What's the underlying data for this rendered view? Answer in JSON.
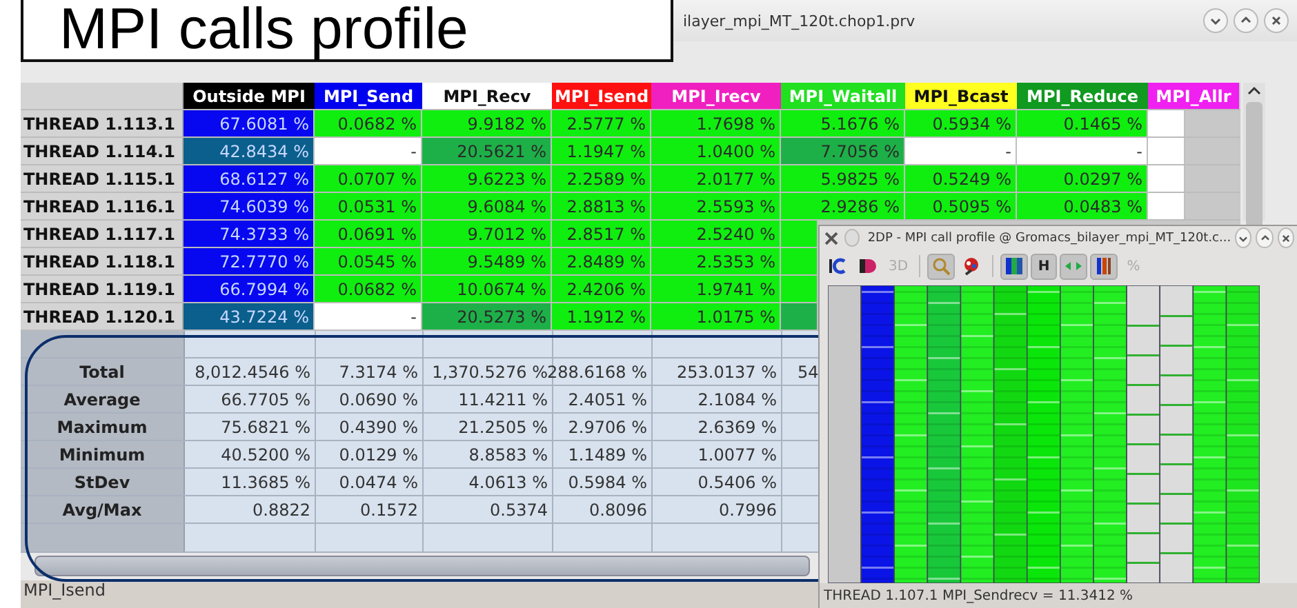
{
  "callout": {
    "title": "MPI calls profile"
  },
  "window": {
    "title": "ilayer_mpi_MT_120t.chop1.prv"
  },
  "table": {
    "columns": [
      {
        "name": "Outside MPI",
        "color": "#000000"
      },
      {
        "name": "MPI_Send",
        "color": "#0000f0"
      },
      {
        "name": "MPI_Recv",
        "color": "#ffffff"
      },
      {
        "name": "MPI_Isend",
        "color": "#ff1010"
      },
      {
        "name": "MPI_Irecv",
        "color": "#f020c0"
      },
      {
        "name": "MPI_Waitall",
        "color": "#20e020"
      },
      {
        "name": "MPI_Bcast",
        "color": "#ffff20"
      },
      {
        "name": "MPI_Reduce",
        "color": "#109a20"
      },
      {
        "name": "MPI_Allr",
        "color": "#f020f0"
      }
    ],
    "rows": [
      {
        "label": "THREAD 1.113.1",
        "cells": [
          {
            "value": "67.6081 %",
            "color": "#0808f0"
          },
          {
            "value": "0.0682 %",
            "color": "#10ee10"
          },
          {
            "value": "9.9182 %",
            "color": "#10ee10"
          },
          {
            "value": "2.5777 %",
            "color": "#10ee10"
          },
          {
            "value": "1.7698 %",
            "color": "#10ee10"
          },
          {
            "value": "5.1676 %",
            "color": "#10ee10"
          },
          {
            "value": "0.5934 %",
            "color": "#10ee10"
          },
          {
            "value": "0.1465 %",
            "color": "#10ee10"
          },
          {
            "color": "#ffffff"
          }
        ]
      },
      {
        "label": "THREAD 1.114.1",
        "cells": [
          {
            "value": "42.8434 %",
            "color": "#0a5f8c"
          },
          {
            "value": "-",
            "color": "#ffffff"
          },
          {
            "value": "20.5621 %",
            "color": "#1eb048"
          },
          {
            "value": "1.1947 %",
            "color": "#10ee10"
          },
          {
            "value": "1.0400 %",
            "color": "#10ee10"
          },
          {
            "value": "7.7056 %",
            "color": "#1eb048"
          },
          {
            "value": "-",
            "color": "#ffffff"
          },
          {
            "value": "-",
            "color": "#ffffff"
          },
          {
            "color": "#ffffff"
          }
        ]
      },
      {
        "label": "THREAD 1.115.1",
        "cells": [
          {
            "value": "68.6127 %",
            "color": "#0808f0"
          },
          {
            "value": "0.0707 %",
            "color": "#10ee10"
          },
          {
            "value": "9.6223 %",
            "color": "#10ee10"
          },
          {
            "value": "2.2589 %",
            "color": "#10ee10"
          },
          {
            "value": "2.0177 %",
            "color": "#10ee10"
          },
          {
            "value": "5.9825 %",
            "color": "#10ee10"
          },
          {
            "value": "0.5249 %",
            "color": "#10ee10"
          },
          {
            "value": "0.0297 %",
            "color": "#10ee10"
          },
          {
            "color": "#ffffff"
          }
        ]
      },
      {
        "label": "THREAD 1.116.1",
        "cells": [
          {
            "value": "74.6039 %",
            "color": "#0808f0"
          },
          {
            "value": "0.0531 %",
            "color": "#10ee10"
          },
          {
            "value": "9.6084 %",
            "color": "#10ee10"
          },
          {
            "value": "2.8813 %",
            "color": "#10ee10"
          },
          {
            "value": "2.5593 %",
            "color": "#10ee10"
          },
          {
            "value": "2.9286 %",
            "color": "#10ee10"
          },
          {
            "value": "0.5095 %",
            "color": "#10ee10"
          },
          {
            "value": "0.0483 %",
            "color": "#10ee10"
          },
          {
            "color": "#ffffff"
          }
        ]
      },
      {
        "label": "THREAD 1.117.1",
        "cells": [
          {
            "value": "74.3733 %",
            "color": "#0808f0"
          },
          {
            "value": "0.0691 %",
            "color": "#10ee10"
          },
          {
            "value": "9.7012 %",
            "color": "#10ee10"
          },
          {
            "value": "2.8517 %",
            "color": "#10ee10"
          },
          {
            "value": "2.5240 %",
            "color": "#10ee10"
          },
          {
            "color": "#10ee10"
          }
        ]
      },
      {
        "label": "THREAD 1.118.1",
        "cells": [
          {
            "value": "72.7770 %",
            "color": "#0808f0"
          },
          {
            "value": "0.0545 %",
            "color": "#10ee10"
          },
          {
            "value": "9.5489 %",
            "color": "#10ee10"
          },
          {
            "value": "2.8489 %",
            "color": "#10ee10"
          },
          {
            "value": "2.5353 %",
            "color": "#10ee10"
          },
          {
            "color": "#10ee10"
          }
        ]
      },
      {
        "label": "THREAD 1.119.1",
        "cells": [
          {
            "value": "66.7994 %",
            "color": "#0808f0"
          },
          {
            "value": "0.0682 %",
            "color": "#10ee10"
          },
          {
            "value": "10.0674 %",
            "color": "#10ee10"
          },
          {
            "value": "2.4206 %",
            "color": "#10ee10"
          },
          {
            "value": "1.9741 %",
            "color": "#10ee10"
          },
          {
            "color": "#10ee10"
          }
        ]
      },
      {
        "label": "THREAD 1.120.1",
        "cells": [
          {
            "value": "43.7224 %",
            "color": "#0a5f8c"
          },
          {
            "value": "-",
            "color": "#ffffff"
          },
          {
            "value": "20.5273 %",
            "color": "#1eb048"
          },
          {
            "value": "1.1912 %",
            "color": "#10ee10"
          },
          {
            "value": "1.0175 %",
            "color": "#10ee10"
          },
          {
            "color": "#1eb048"
          }
        ]
      }
    ],
    "stats": [
      {
        "label": "Total",
        "values": [
          "8,012.4546 %",
          "7.3174 %",
          "1,370.5276 %",
          "288.6168 %",
          "253.0137 %",
          "54"
        ]
      },
      {
        "label": "Average",
        "values": [
          "66.7705 %",
          "0.0690 %",
          "11.4211 %",
          "2.4051 %",
          "2.1084 %"
        ]
      },
      {
        "label": "Maximum",
        "values": [
          "75.6821 %",
          "0.4390 %",
          "21.2505 %",
          "2.9706 %",
          "2.6369 %"
        ]
      },
      {
        "label": "Minimum",
        "values": [
          "40.5200 %",
          "0.0129 %",
          "8.8583 %",
          "1.1489 %",
          "1.0077 %"
        ]
      },
      {
        "label": "StDev",
        "values": [
          "11.3685 %",
          "0.0474 %",
          "4.0613 %",
          "0.5984 %",
          "0.5406 %"
        ]
      },
      {
        "label": "Avg/Max",
        "values": [
          "0.8822",
          "0.1572",
          "0.5374",
          "0.8096",
          "0.7996"
        ]
      }
    ]
  },
  "status_bar": {
    "text": "MPI_Isend"
  },
  "popup": {
    "title": "2DP - MPI call profile @ Gromacs_bilayer_mpi_MT_120t.c...",
    "toolbar": [
      {
        "kind": "fit",
        "pressed": false
      },
      {
        "kind": "codes",
        "pressed": false
      },
      {
        "kind": "label",
        "label": "3D",
        "pressed": false,
        "disabled": true
      },
      {
        "kind": "separator"
      },
      {
        "kind": "zoom",
        "pressed": true
      },
      {
        "kind": "palette",
        "pressed": false
      },
      {
        "kind": "separator"
      },
      {
        "kind": "bars",
        "pressed": true
      },
      {
        "kind": "label",
        "label": "H",
        "pressed": true,
        "disabled": false
      },
      {
        "kind": "arrows",
        "pressed": true
      },
      {
        "kind": "stripes",
        "pressed": true
      },
      {
        "kind": "label",
        "label": "%",
        "pressed": false,
        "disabled": true
      }
    ],
    "columns": [
      {
        "kind": "empty",
        "color": "#c8c8c8"
      },
      {
        "kind": "striped",
        "color": "#0a14e6"
      },
      {
        "kind": "striped",
        "color": "#22ee22"
      },
      {
        "kind": "striped",
        "color": "#18c83a"
      },
      {
        "kind": "striped",
        "color": "#22ee22"
      },
      {
        "kind": "striped",
        "color": "#12d812"
      },
      {
        "kind": "striped",
        "color": "#0ae60a"
      },
      {
        "kind": "striped",
        "color": "#22ee22"
      },
      {
        "kind": "striped",
        "color": "#22ee22"
      },
      {
        "kind": "sparse",
        "color": "#dcdcdc"
      },
      {
        "kind": "sparse",
        "color": "#dcdcdc"
      },
      {
        "kind": "striped",
        "color": "#22ee22"
      },
      {
        "kind": "striped",
        "color": "#1ee61e"
      }
    ],
    "status": "THREAD 1.107.1  MPI_Sendrecv  = 11.3412 %"
  }
}
